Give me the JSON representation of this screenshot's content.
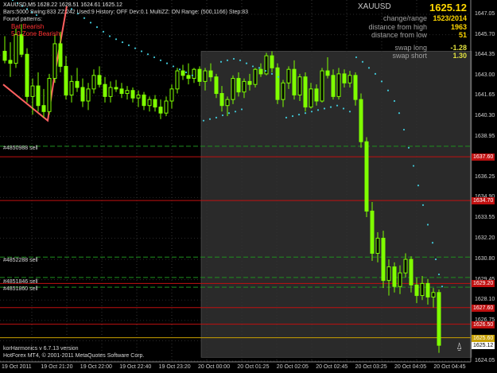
{
  "header": {
    "symbol_line": "XAUUSD,M5  1628.22 1628.51 1624.61 1625.12",
    "info_line": "Bars:5000  Swing:833  ZZ:242  Used:9  History: OFF Dev:0.1  MultiZZ: ON  Range: (500,1166)  Step:83",
    "found_label": "Found patterns:",
    "patterns": [
      "Bat Bearish",
      "5-0 Zone Bearish"
    ]
  },
  "panel": {
    "symbol": "XAUUSD",
    "price": "1625.12",
    "rows": [
      {
        "label": "change/range",
        "value": "1523/2014"
      },
      {
        "label": "distance from high",
        "value": "1963"
      },
      {
        "label": "distance from low",
        "value": "51"
      },
      {
        "label": "swap long",
        "value": "-1.28"
      },
      {
        "label": "swap short",
        "value": "1.30"
      }
    ]
  },
  "orders": [
    {
      "label": "#4850988 sell",
      "price": 1638.3
    },
    {
      "label": "#4852288 sell",
      "price": 1630.95
    },
    {
      "label": "#4851846 sell",
      "price": 1629.6
    },
    {
      "label": "#4851860 sell",
      "price": 1628.95
    }
  ],
  "price_axis": {
    "min": 1624.0,
    "max": 1648.0,
    "ticks": [
      "1647.05",
      "1645.70",
      "1644.35",
      "1643.00",
      "1641.65",
      "1640.30",
      "1638.95",
      "1636.25",
      "1634.90",
      "1633.55",
      "1632.20",
      "1630.80",
      "1629.45",
      "1628.10",
      "1626.75",
      "1625.40",
      "1624.05"
    ],
    "level_tags": [
      {
        "value": "1637.6",
        "text": "1637.60",
        "color": "#c01010"
      },
      {
        "value": "1634.7",
        "text": "1634.70",
        "color": "#c01010"
      },
      {
        "value": "1629.2",
        "text": "1629.20",
        "color": "#c01010"
      },
      {
        "value": "1627.6",
        "text": "1627.60",
        "color": "#c01010"
      },
      {
        "value": "1626.5",
        "text": "1626.50",
        "color": "#c01010"
      },
      {
        "value": "1625.6",
        "text": "1625.60",
        "color": "#c8a000"
      },
      {
        "value": "1625.12",
        "text": "1625.12",
        "color": "#ffffff"
      }
    ]
  },
  "time_axis": [
    "19 Oct 2011",
    "19 Oct 21:20",
    "19 Oct 22:00",
    "19 Oct 22:40",
    "19 Oct 23:20",
    "20 Oct 00:00",
    "20 Oct 01:25",
    "20 Oct 02:05",
    "20 Oct 02:45",
    "20 Oct 03:25",
    "20 Oct 04:05",
    "20 Oct 04:45"
  ],
  "footer": {
    "line1": "korHarmonics v 6.7.13 version",
    "line2": "HotForex MT4, © 2001-2011 MetaQuotes Software Corp."
  },
  "colors": {
    "candle": "#7fff00",
    "sar": "#40c8d8",
    "zigzag": "#ff6060",
    "red_level": "#c01010",
    "green_level": "#1f8f1f",
    "zone": "#2a2a2a"
  },
  "candles": [
    [
      1644.6,
      1645.6,
      1643.8,
      1644.0
    ],
    [
      1644.0,
      1645.2,
      1642.9,
      1643.8
    ],
    [
      1643.8,
      1646.1,
      1643.5,
      1645.7
    ],
    [
      1645.7,
      1646.4,
      1644.2,
      1644.4
    ],
    [
      1644.4,
      1644.8,
      1641.2,
      1641.6
    ],
    [
      1641.6,
      1642.8,
      1640.4,
      1642.3
    ],
    [
      1642.3,
      1643.2,
      1640.6,
      1641.0
    ],
    [
      1641.0,
      1642.1,
      1640.2,
      1640.6
    ],
    [
      1640.6,
      1643.1,
      1640.4,
      1642.8
    ],
    [
      1642.8,
      1645.7,
      1642.5,
      1645.1
    ],
    [
      1645.1,
      1645.9,
      1643.2,
      1643.6
    ],
    [
      1643.6,
      1644.3,
      1641.4,
      1641.7
    ],
    [
      1641.7,
      1643.0,
      1641.2,
      1642.6
    ],
    [
      1642.6,
      1643.5,
      1641.9,
      1642.2
    ],
    [
      1642.2,
      1642.8,
      1640.9,
      1641.3
    ],
    [
      1641.3,
      1642.5,
      1640.7,
      1642.1
    ],
    [
      1642.1,
      1643.4,
      1641.8,
      1643.0
    ],
    [
      1643.0,
      1643.6,
      1642.2,
      1642.4
    ],
    [
      1642.4,
      1642.9,
      1641.2,
      1641.6
    ],
    [
      1641.6,
      1642.6,
      1641.2,
      1642.2
    ],
    [
      1642.2,
      1642.7,
      1641.9,
      1642.1
    ],
    [
      1642.1,
      1642.5,
      1641.5,
      1641.8
    ],
    [
      1641.8,
      1642.3,
      1641.4,
      1642.0
    ],
    [
      1642.0,
      1642.2,
      1641.2,
      1641.5
    ],
    [
      1641.5,
      1642.0,
      1640.9,
      1641.7
    ],
    [
      1641.7,
      1641.9,
      1640.7,
      1641.0
    ],
    [
      1641.0,
      1641.6,
      1640.6,
      1641.4
    ],
    [
      1641.4,
      1641.7,
      1640.6,
      1640.9
    ],
    [
      1640.9,
      1641.4,
      1640.1,
      1640.5
    ],
    [
      1640.5,
      1641.6,
      1640.3,
      1641.3
    ],
    [
      1641.3,
      1642.4,
      1640.8,
      1642.1
    ],
    [
      1642.1,
      1643.5,
      1641.8,
      1643.3
    ],
    [
      1643.3,
      1643.7,
      1642.7,
      1643.0
    ],
    [
      1643.0,
      1643.8,
      1642.4,
      1642.8
    ],
    [
      1642.8,
      1643.5,
      1642.5,
      1643.4
    ],
    [
      1643.4,
      1643.6,
      1642.3,
      1642.6
    ],
    [
      1642.6,
      1643.5,
      1642.0,
      1643.3
    ],
    [
      1643.3,
      1643.8,
      1642.6,
      1642.9
    ],
    [
      1642.9,
      1643.1,
      1641.5,
      1641.8
    ],
    [
      1641.8,
      1642.3,
      1640.6,
      1641.0
    ],
    [
      1641.0,
      1641.6,
      1640.3,
      1641.4
    ],
    [
      1641.4,
      1643.0,
      1641.1,
      1642.8
    ],
    [
      1642.8,
      1643.2,
      1641.6,
      1641.9
    ],
    [
      1641.9,
      1642.8,
      1641.5,
      1642.6
    ],
    [
      1642.6,
      1643.1,
      1642.0,
      1642.4
    ],
    [
      1642.4,
      1643.5,
      1642.2,
      1643.4
    ],
    [
      1643.4,
      1643.8,
      1642.9,
      1643.1
    ],
    [
      1643.1,
      1644.5,
      1643.0,
      1644.3
    ],
    [
      1644.3,
      1644.6,
      1643.2,
      1643.5
    ],
    [
      1643.5,
      1643.8,
      1641.1,
      1641.4
    ],
    [
      1641.4,
      1642.7,
      1640.9,
      1642.5
    ],
    [
      1642.5,
      1643.6,
      1642.1,
      1643.4
    ],
    [
      1643.4,
      1644.0,
      1641.4,
      1641.7
    ],
    [
      1641.7,
      1643.1,
      1641.3,
      1642.9
    ],
    [
      1642.9,
      1643.2,
      1640.6,
      1640.9
    ],
    [
      1640.9,
      1642.5,
      1640.8,
      1642.1
    ],
    [
      1642.1,
      1642.4,
      1641.0,
      1641.3
    ],
    [
      1641.3,
      1643.5,
      1641.2,
      1643.3
    ],
    [
      1643.3,
      1644.2,
      1642.8,
      1643.0
    ],
    [
      1643.0,
      1643.4,
      1641.4,
      1641.6
    ],
    [
      1641.6,
      1643.5,
      1641.4,
      1643.1
    ],
    [
      1643.1,
      1643.4,
      1642.2,
      1642.5
    ],
    [
      1642.5,
      1643.3,
      1642.2,
      1643.0
    ],
    [
      1643.0,
      1643.2,
      1641.0,
      1641.4
    ],
    [
      1641.4,
      1641.8,
      1638.2,
      1638.6
    ],
    [
      1638.6,
      1638.9,
      1633.6,
      1634.0
    ],
    [
      1634.0,
      1634.6,
      1630.7,
      1631.2
    ],
    [
      1631.2,
      1632.6,
      1630.6,
      1632.2
    ],
    [
      1632.2,
      1632.7,
      1628.9,
      1629.4
    ],
    [
      1629.4,
      1630.8,
      1628.4,
      1630.3
    ],
    [
      1630.3,
      1630.6,
      1628.6,
      1629.0
    ],
    [
      1629.0,
      1630.4,
      1628.5,
      1629.9
    ],
    [
      1629.9,
      1631.2,
      1629.6,
      1630.8
    ],
    [
      1630.8,
      1631.0,
      1628.6,
      1629.1
    ],
    [
      1629.1,
      1629.6,
      1627.9,
      1628.4
    ],
    [
      1628.4,
      1629.7,
      1628.1,
      1629.2
    ],
    [
      1629.2,
      1629.5,
      1627.8,
      1628.3
    ],
    [
      1628.3,
      1628.9,
      1627.6,
      1628.6
    ],
    [
      1628.6,
      1628.8,
      1624.6,
      1625.1
    ]
  ],
  "sar": [
    [
      16,
      1648.0
    ],
    [
      22,
      1647.8
    ],
    [
      28,
      1647.6
    ],
    [
      34,
      1647.4
    ],
    [
      40,
      1647.2
    ],
    [
      46,
      1647.0
    ],
    [
      90,
      1647.4
    ],
    [
      98,
      1647.1
    ],
    [
      106,
      1646.8
    ],
    [
      114,
      1646.5
    ],
    [
      122,
      1646.2
    ],
    [
      130,
      1645.9
    ],
    [
      138,
      1645.6
    ],
    [
      146,
      1645.4
    ],
    [
      154,
      1645.2
    ],
    [
      162,
      1645.0
    ],
    [
      170,
      1644.8
    ],
    [
      178,
      1644.6
    ],
    [
      186,
      1644.4
    ],
    [
      194,
      1644.2
    ],
    [
      202,
      1644.0
    ],
    [
      210,
      1643.8
    ],
    [
      218,
      1643.6
    ],
    [
      226,
      1643.4
    ],
    [
      234,
      1643.2
    ],
    [
      242,
      1643.0
    ],
    [
      256,
      1640.0
    ],
    [
      264,
      1640.1
    ],
    [
      272,
      1640.2
    ],
    [
      280,
      1640.35
    ],
    [
      288,
      1640.5
    ],
    [
      296,
      1640.6
    ],
    [
      304,
      1640.75
    ],
    [
      278,
      1643.9
    ],
    [
      286,
      1644.0
    ],
    [
      294,
      1644.1
    ],
    [
      302,
      1644.0
    ],
    [
      310,
      1643.8
    ],
    [
      318,
      1643.6
    ],
    [
      326,
      1643.5
    ],
    [
      334,
      1643.3
    ],
    [
      342,
      1643.1
    ],
    [
      350,
      1642.9
    ],
    [
      360,
      1640.2
    ],
    [
      368,
      1640.3
    ],
    [
      376,
      1640.4
    ],
    [
      384,
      1640.5
    ],
    [
      392,
      1640.6
    ],
    [
      400,
      1640.7
    ],
    [
      408,
      1640.8
    ],
    [
      416,
      1640.9
    ],
    [
      424,
      1641.0
    ],
    [
      432,
      1640.8
    ],
    [
      440,
      1640.6
    ],
    [
      448,
      1644.2
    ],
    [
      456,
      1643.9
    ],
    [
      464,
      1643.5
    ],
    [
      472,
      1643.1
    ],
    [
      480,
      1642.6
    ],
    [
      488,
      1642.0
    ],
    [
      496,
      1641.3
    ],
    [
      502,
      1640.5
    ],
    [
      508,
      1639.4
    ],
    [
      514,
      1638.2
    ],
    [
      520,
      1637.0
    ],
    [
      526,
      1635.7
    ],
    [
      532,
      1634.4
    ],
    [
      538,
      1633.1
    ],
    [
      544,
      1631.9
    ],
    [
      548,
      1630.8
    ],
    [
      552,
      1629.8
    ],
    [
      556,
      1629.0
    ]
  ],
  "zigzag": [
    [
      4,
      1642.4
    ],
    [
      60,
      1640.0
    ],
    [
      68,
      1642.8
    ],
    [
      84,
      1647.6
    ]
  ]
}
